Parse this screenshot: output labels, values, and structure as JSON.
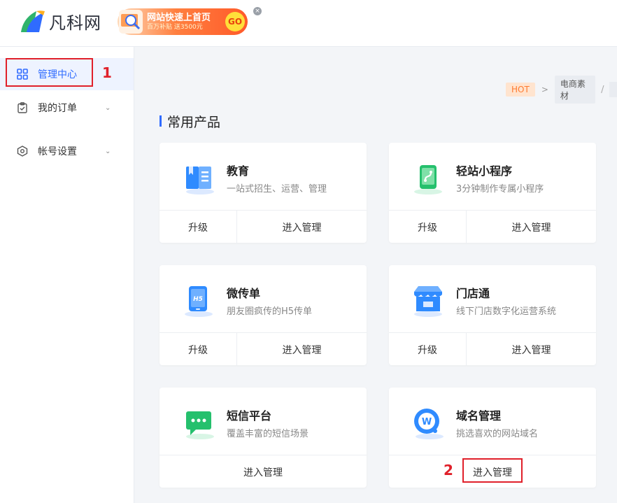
{
  "header": {
    "logo_text": "凡科网",
    "promo": {
      "title": "网站快速上首页",
      "subtitle": "百万补贴 送3500元",
      "go": "GO"
    },
    "close": "×"
  },
  "sidebar": {
    "items": [
      {
        "label": "管理中心",
        "icon": "grid-icon",
        "active": true
      },
      {
        "label": "我的订单",
        "icon": "clipboard-check-icon",
        "chevron": "⌄"
      },
      {
        "label": "帐号设置",
        "icon": "hexagon-settings-icon",
        "chevron": "⌄"
      }
    ]
  },
  "annotations": {
    "step1": "1",
    "step2": "2"
  },
  "breadcrumb": {
    "hot": "HOT",
    "sep": ">",
    "category": "电商素材",
    "slash": "/"
  },
  "section": {
    "title": "常用产品"
  },
  "cards": [
    {
      "title": "教育",
      "desc": "一站式招生、运营、管理",
      "upgrade": "升级",
      "manage": "进入管理",
      "icon": "book-icon",
      "color": "#2f8bff"
    },
    {
      "title": "轻站小程序",
      "desc": "3分钟制作专属小程序",
      "upgrade": "升级",
      "manage": "进入管理",
      "icon": "miniapp-phone-icon",
      "color": "#25c06d"
    },
    {
      "title": "微传单",
      "desc": "朋友圈疯传的H5传单",
      "upgrade": "升级",
      "manage": "进入管理",
      "icon": "h5-phone-icon",
      "color": "#2f8bff"
    },
    {
      "title": "门店通",
      "desc": "线下门店数字化运营系统",
      "upgrade": "升级",
      "manage": "进入管理",
      "icon": "store-icon",
      "color": "#2f8bff"
    },
    {
      "title": "短信平台",
      "desc": "覆盖丰富的短信场景",
      "manage": "进入管理",
      "icon": "sms-bubble-icon",
      "color": "#25c06d"
    },
    {
      "title": "域名管理",
      "desc": "挑选喜欢的网站域名",
      "manage": "进入管理",
      "icon": "domain-w-icon",
      "color": "#2f8bff"
    }
  ]
}
